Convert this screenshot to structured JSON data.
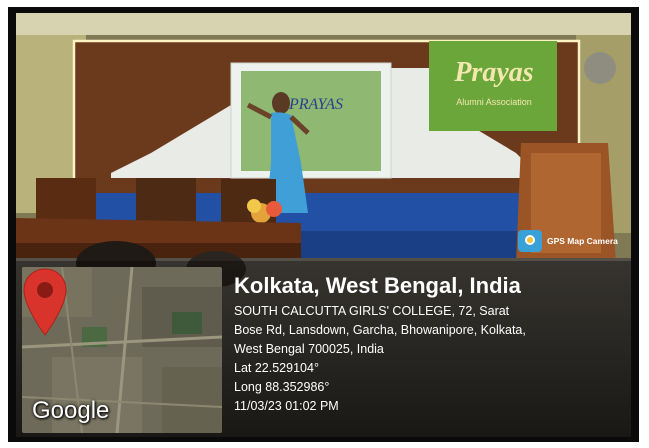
{
  "scene": {
    "banner_text": "Prayas",
    "banner_subtext": "Alumni Association",
    "screen_text": "PRAYAS"
  },
  "camera_badge": {
    "label": "GPS Map Camera",
    "icon": "camera-icon"
  },
  "map": {
    "brand": "Google",
    "pin_icon": "location-pin-icon"
  },
  "location": {
    "city": "Kolkata, West Bengal, India",
    "address_line1": "SOUTH CALCUTTA GIRLS' COLLEGE, 72, Sarat",
    "address_line2": "Bose Rd, Lansdown, Garcha, Bhowanipore, Kolkata,",
    "address_line3": "West Bengal 700025, India",
    "lat": "Lat 22.529104°",
    "long": "Long 88.352986°",
    "datetime": "11/03/23 01:02 PM"
  },
  "colors": {
    "pin": "#d9342b",
    "banner": "#6aa63a",
    "saree": "#3f9fd6",
    "stage_skirt": "#1f4fa8",
    "wood": "#8b4a22"
  }
}
